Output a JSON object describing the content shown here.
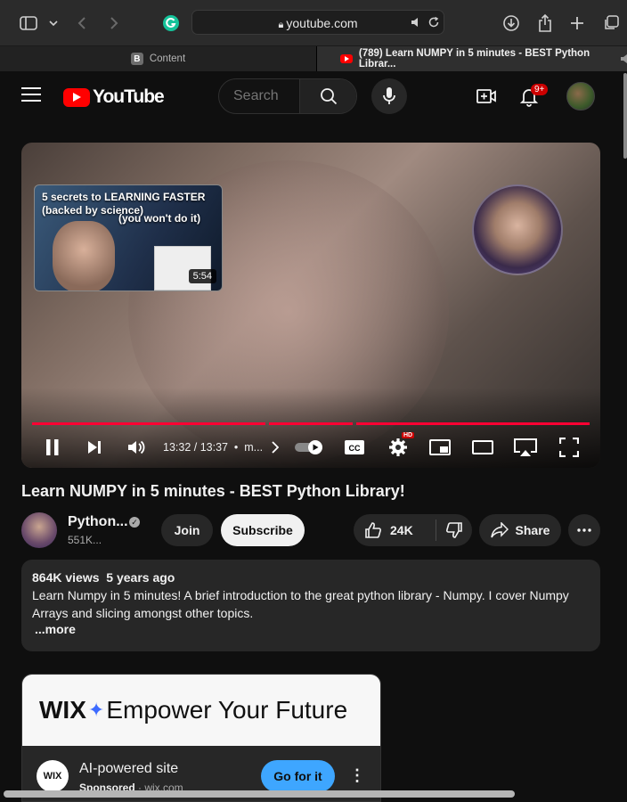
{
  "browser": {
    "url": "youtube.com",
    "tabs": [
      {
        "label": "Content",
        "favicon_letter": "B"
      },
      {
        "label": "(789) Learn NUMPY in 5 minutes - BEST Python Librar..."
      }
    ]
  },
  "header": {
    "logo_text": "YouTube",
    "search_placeholder": "Search",
    "notification_count": "9+"
  },
  "player": {
    "endcard": {
      "title_line1": "5 secrets to LEARNING FASTER",
      "title_line2": "(backed by science)",
      "overlay_text": "(you won't do it)",
      "duration": "5:54"
    },
    "time": "13:32 / 13:37",
    "chapter": "m...",
    "progress_fraction": 0.993,
    "hd_badge": "HD"
  },
  "video": {
    "title": "Learn NUMPY in 5 minutes - BEST Python Library!",
    "channel_name": "Python...",
    "subscribers": "551K...",
    "join_label": "Join",
    "subscribe_label": "Subscribe",
    "likes": "24K",
    "share_label": "Share"
  },
  "description": {
    "views": "864K views",
    "age": "5 years ago",
    "text": "Learn Numpy in 5 minutes! A brief introduction to the great python library - Numpy. I cover Numpy Arrays and slicing amongst other topics.",
    "more_label": "...more"
  },
  "ad": {
    "banner_brand": "WIX",
    "banner_tagline": "Empower Your Future",
    "logo_text": "WIX",
    "title": "AI-powered site",
    "sponsored_label": "Sponsored",
    "domain": "wix.com",
    "cta_label": "Go for it"
  },
  "colors": {
    "accent_red": "#ff0000",
    "progress_red": "#ff0033",
    "cta_blue": "#3ea6ff",
    "background": "#0f0f0f"
  }
}
